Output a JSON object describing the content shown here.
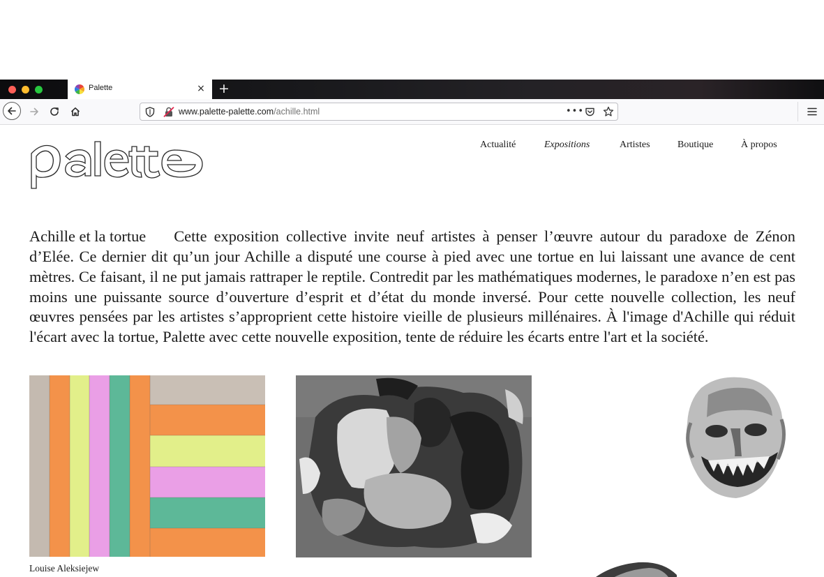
{
  "browser": {
    "tab_title": "Palette",
    "new_tab_label": "+",
    "tab_close_label": "×",
    "url_host": "www.palette-palette.com",
    "url_path": "/achille.html",
    "more_label": "•••"
  },
  "site": {
    "logo_text": "palette",
    "nav": [
      "Actualité",
      "Expositions",
      "Artistes",
      "Boutique",
      "À propos"
    ]
  },
  "exhibition": {
    "title": "Achille et la tortue",
    "description": "Cette exposition collective invite neuf artistes à penser l’œuvre autour du paradoxe de Zénon d’Elée. Ce dernier dit qu’un jour Achille a disputé une course à pied avec une tortue en lui laissant une avance de cent mètres. Ce faisant, il ne put jamais rattraper le reptile. Contredit par les mathématiques modernes, le paradoxe n’en est pas moins une puissante source d’ouverture d’esprit et d’état du monde inversé. Pour cette nouvelle collection, les neuf œuvres pensées par les artistes s’approprient cette histoire vieille de plusieurs mil­lé­naires. À l'image d'Achille qui réduit l'écart avec la tortue, Palette avec cette nouvelle exposition, tente de réduire les écarts entre l'art et la société."
  },
  "artworks": [
    {
      "caption": "Louise Aleksiejew"
    }
  ],
  "colors": {
    "titlebar": "#141416",
    "toolbar": "#f9f9fb",
    "text": "#1a1a1a",
    "art_orange": "#f3924a",
    "art_yellow": "#e2ef8a",
    "art_pink": "#ea9fe6",
    "art_teal": "#5db898",
    "art_grey": "#c9bfb5"
  }
}
